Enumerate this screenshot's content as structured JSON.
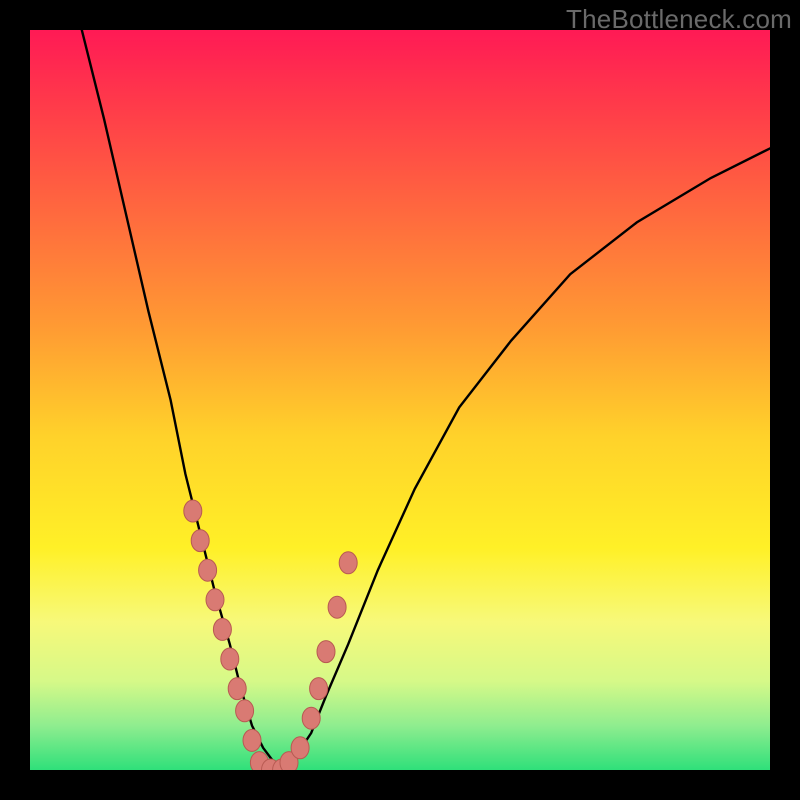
{
  "watermark": "TheBottleneck.com",
  "colors": {
    "frame": "#000000",
    "curve": "#000000",
    "marker_fill": "#d97a73",
    "marker_stroke": "#b85a52",
    "gradient_stops": [
      {
        "offset": 0,
        "color": "#ff1a55"
      },
      {
        "offset": 10,
        "color": "#ff3a4a"
      },
      {
        "offset": 25,
        "color": "#ff6a3e"
      },
      {
        "offset": 40,
        "color": "#ff9a33"
      },
      {
        "offset": 55,
        "color": "#ffd22a"
      },
      {
        "offset": 70,
        "color": "#fff027"
      },
      {
        "offset": 80,
        "color": "#f7f97a"
      },
      {
        "offset": 88,
        "color": "#d6f988"
      },
      {
        "offset": 94,
        "color": "#8fed8f"
      },
      {
        "offset": 100,
        "color": "#2fe07a"
      }
    ]
  },
  "chart_data": {
    "type": "line",
    "title": "",
    "xlabel": "",
    "ylabel": "",
    "xlim": [
      0,
      100
    ],
    "ylim": [
      0,
      100
    ],
    "note": "x and y are percentages of the plot area (0 = left/bottom, 100 = right/top). The curve resembles a bottleneck V-shape.",
    "series": [
      {
        "name": "bottleneck-curve",
        "x": [
          7,
          10,
          13,
          16,
          19,
          21,
          23,
          25,
          27,
          28.5,
          30,
          31.5,
          33,
          34,
          36,
          38,
          40,
          43,
          47,
          52,
          58,
          65,
          73,
          82,
          92,
          100
        ],
        "y": [
          100,
          88,
          75,
          62,
          50,
          40,
          32,
          24,
          17,
          11,
          6,
          3,
          1,
          0,
          2,
          5,
          10,
          17,
          27,
          38,
          49,
          58,
          67,
          74,
          80,
          84
        ]
      }
    ],
    "markers": {
      "name": "highlighted-points",
      "note": "Pink bead markers clustered near the V bottom.",
      "x": [
        22,
        23,
        24,
        25,
        26,
        27,
        28,
        29,
        30,
        31,
        32.5,
        34,
        35,
        36.5,
        38,
        39,
        40,
        41.5,
        43
      ],
      "y": [
        35,
        31,
        27,
        23,
        19,
        15,
        11,
        8,
        4,
        1,
        0,
        0,
        1,
        3,
        7,
        11,
        16,
        22,
        28
      ]
    }
  }
}
